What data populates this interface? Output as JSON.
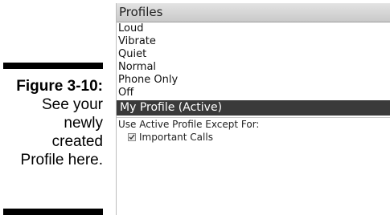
{
  "caption": {
    "figure_number": "Figure 3-10:",
    "lines": [
      "See your",
      "newly",
      "created",
      "Profile here."
    ]
  },
  "screen": {
    "title": "Profiles",
    "profiles": [
      "Loud",
      "Vibrate",
      "Quiet",
      "Normal",
      "Phone Only",
      "Off"
    ],
    "active_profile": "My Profile (Active)",
    "exception_label": "Use Active Profile Except For:",
    "exception_item": {
      "label": "Important Calls",
      "checked": true
    }
  }
}
